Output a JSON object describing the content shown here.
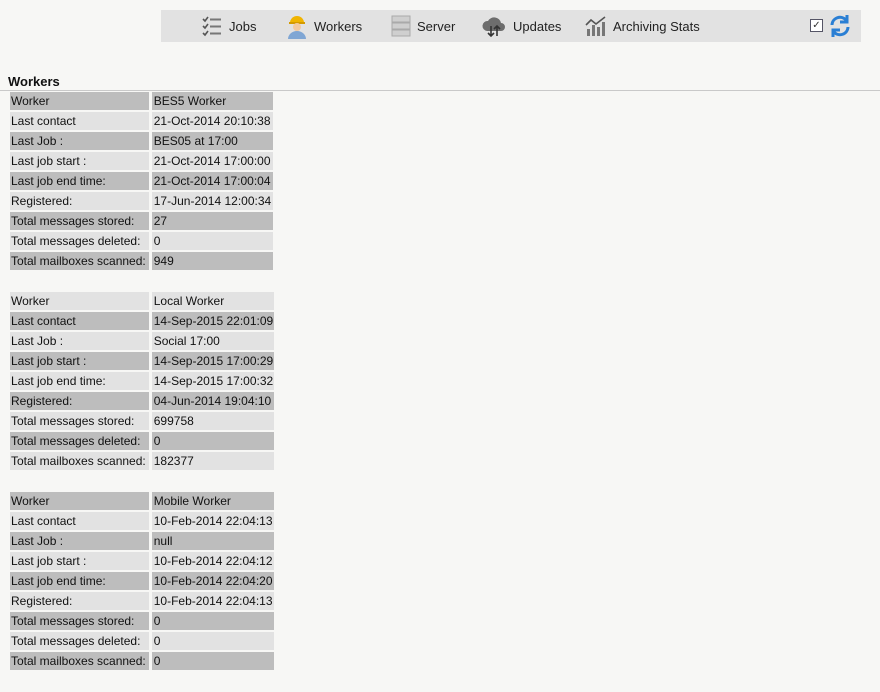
{
  "toolbar": {
    "items": [
      {
        "label": "Jobs",
        "icon": "checklist-icon"
      },
      {
        "label": "Workers",
        "icon": "worker-icon"
      },
      {
        "label": "Server",
        "icon": "server-icon"
      },
      {
        "label": "Updates",
        "icon": "cloud-updates-icon"
      },
      {
        "label": "Archiving Stats",
        "icon": "stats-icon"
      }
    ],
    "checkbox_checked": true,
    "accent": "#2a7fd4"
  },
  "section": {
    "title": "Workers"
  },
  "workers": [
    {
      "rows": [
        {
          "label": "Worker",
          "value": "BES5 Worker",
          "shade": "dark"
        },
        {
          "label": "Last contact",
          "value": "21-Oct-2014 20:10:38",
          "shade": "light"
        },
        {
          "label": "Last Job :",
          "value": "BES05 at 17:00",
          "shade": "dark"
        },
        {
          "label": "Last job start :",
          "value": "21-Oct-2014 17:00:00",
          "shade": "light"
        },
        {
          "label": "Last job end time:",
          "value": "21-Oct-2014 17:00:04",
          "shade": "dark"
        },
        {
          "label": "Registered:",
          "value": "17-Jun-2014 12:00:34",
          "shade": "light"
        },
        {
          "label": "Total messages stored:",
          "value": "27",
          "shade": "dark"
        },
        {
          "label": "Total messages deleted:",
          "value": "0",
          "shade": "light"
        },
        {
          "label": "Total mailboxes scanned:",
          "value": "949",
          "shade": "dark"
        }
      ]
    },
    {
      "rows": [
        {
          "label": "Worker",
          "value": "Local Worker",
          "shade": "light"
        },
        {
          "label": "Last contact",
          "value": "14-Sep-2015 22:01:09",
          "shade": "dark"
        },
        {
          "label": "Last Job :",
          "value": "Social 17:00",
          "shade": "light"
        },
        {
          "label": "Last job start :",
          "value": "14-Sep-2015 17:00:29",
          "shade": "dark"
        },
        {
          "label": "Last job end time:",
          "value": "14-Sep-2015 17:00:32",
          "shade": "light"
        },
        {
          "label": "Registered:",
          "value": "04-Jun-2014 19:04:10",
          "shade": "dark"
        },
        {
          "label": "Total messages stored:",
          "value": "699758",
          "shade": "light"
        },
        {
          "label": "Total messages deleted:",
          "value": "0",
          "shade": "dark"
        },
        {
          "label": "Total mailboxes scanned:",
          "value": "182377",
          "shade": "light"
        }
      ]
    },
    {
      "rows": [
        {
          "label": "Worker",
          "value": "Mobile Worker",
          "shade": "dark"
        },
        {
          "label": "Last contact",
          "value": "10-Feb-2014 22:04:13",
          "shade": "light"
        },
        {
          "label": "Last Job :",
          "value": "null",
          "shade": "dark"
        },
        {
          "label": "Last job start :",
          "value": "10-Feb-2014 22:04:12",
          "shade": "light"
        },
        {
          "label": "Last job end time:",
          "value": "10-Feb-2014 22:04:20",
          "shade": "dark"
        },
        {
          "label": "Registered:",
          "value": "10-Feb-2014 22:04:13",
          "shade": "light"
        },
        {
          "label": "Total messages stored:",
          "value": "0",
          "shade": "dark"
        },
        {
          "label": "Total messages deleted:",
          "value": "0",
          "shade": "light"
        },
        {
          "label": "Total mailboxes scanned:",
          "value": "0",
          "shade": "dark"
        }
      ]
    }
  ]
}
